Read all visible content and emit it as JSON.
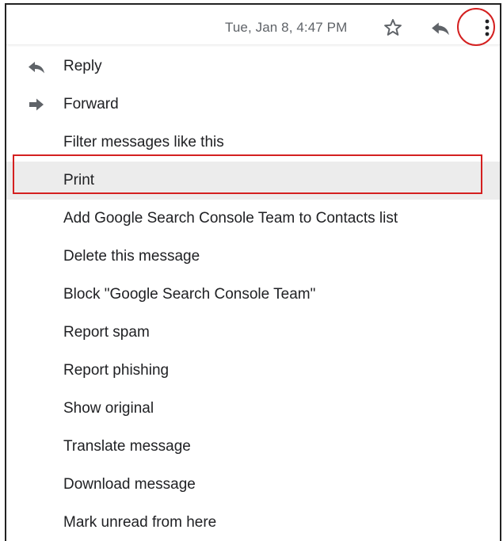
{
  "header": {
    "timestamp": "Tue, Jan 8, 4:47 PM",
    "icons": {
      "star": "star-outline-icon",
      "reply": "reply-icon",
      "more": "more-vertical-icon"
    }
  },
  "menu": {
    "items": [
      {
        "label": "Reply",
        "icon": "reply-icon"
      },
      {
        "label": "Forward",
        "icon": "forward-icon"
      },
      {
        "label": "Filter messages like this"
      },
      {
        "label": "Print"
      },
      {
        "label": "Add Google Search Console Team to Contacts list"
      },
      {
        "label": "Delete this message"
      },
      {
        "label": "Block \"Google Search Console Team\""
      },
      {
        "label": "Report spam"
      },
      {
        "label": "Report phishing"
      },
      {
        "label": "Show original"
      },
      {
        "label": "Translate message"
      },
      {
        "label": "Download message"
      },
      {
        "label": "Mark unread from here"
      }
    ],
    "highlighted_item": "Print"
  },
  "colors": {
    "annotation": "#d42020",
    "highlight_bg": "#ececec",
    "text": "#202124",
    "muted": "#5f6368",
    "icon": "#5f6368"
  }
}
